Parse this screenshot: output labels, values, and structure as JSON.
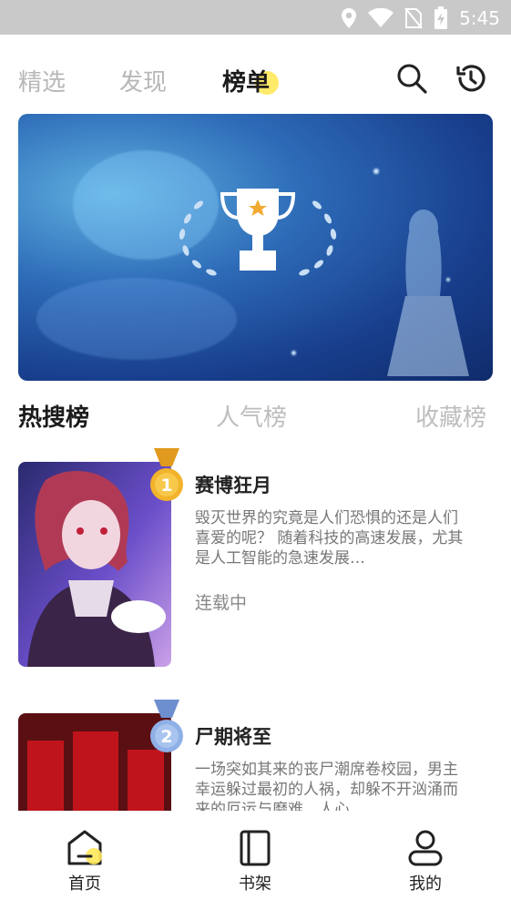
{
  "status_bar": {
    "time": "5:45"
  },
  "top_tabs": [
    {
      "label": "精选",
      "active": false
    },
    {
      "label": "发现",
      "active": false
    },
    {
      "label": "榜单",
      "active": true
    }
  ],
  "top_icons": [
    "search-icon",
    "history-icon"
  ],
  "rank_tabs": [
    {
      "label": "热搜榜",
      "active": true
    },
    {
      "label": "人气榜",
      "active": false
    },
    {
      "label": "收藏榜",
      "active": false
    }
  ],
  "comics": [
    {
      "rank": "1",
      "title": "赛博狂月",
      "desc": "毁灭世界的究竟是人们恐惧的还是人们喜爱的呢？ 随着科技的高速发展，尤其是人工智能的急速发展…",
      "status": "连载中",
      "medal_color": "#f2b32a"
    },
    {
      "rank": "2",
      "title": "尸期将至",
      "desc": "一场突如其来的丧尸潮席卷校园，男主幸运躲过最初的人祸，却躲不开汹涌而来的厄运与磨难，人心…",
      "status": "",
      "medal_color": "#8fb0e6"
    }
  ],
  "bottom_nav": [
    {
      "label": "首页",
      "icon": "home-icon",
      "active": true
    },
    {
      "label": "书架",
      "icon": "bookshelf-icon",
      "active": false
    },
    {
      "label": "我的",
      "icon": "profile-icon",
      "active": false
    }
  ]
}
